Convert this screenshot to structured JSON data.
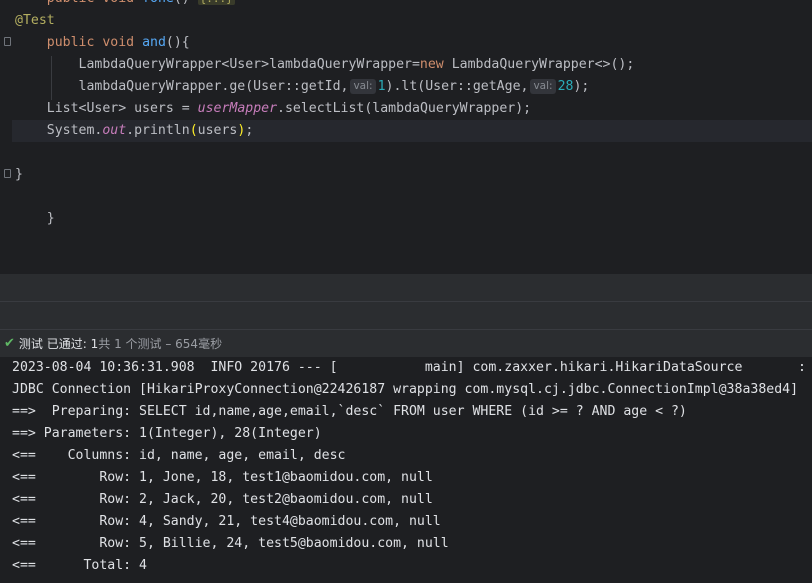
{
  "editor": {
    "lines": [
      {
        "segments": [
          {
            "t": "    "
          },
          {
            "t": "public",
            "c": "kw"
          },
          {
            "t": " "
          },
          {
            "t": "void",
            "c": "kw"
          },
          {
            "t": " "
          },
          {
            "t": "fone",
            "c": "fn"
          },
          {
            "t": "() "
          },
          {
            "t": "{...}",
            "c": "folded"
          }
        ]
      },
      {
        "segments": [
          {
            "t": "@Test",
            "c": "anno"
          }
        ]
      },
      {
        "segments": [
          {
            "t": "    "
          },
          {
            "t": "public",
            "c": "kw"
          },
          {
            "t": " "
          },
          {
            "t": "void",
            "c": "kw"
          },
          {
            "t": " "
          },
          {
            "t": "and",
            "c": "fn"
          },
          {
            "t": "(){"
          }
        ]
      },
      {
        "segments": [
          {
            "t": "        LambdaQueryWrapper<User>lambdaQueryWrapper="
          },
          {
            "t": "new",
            "c": "kw"
          },
          {
            "t": " LambdaQueryWrapper<>();"
          }
        ]
      },
      {
        "segments": [
          {
            "t": "        lambdaQueryWrapper.ge(User::getId,"
          },
          {
            "t": "val:",
            "c": "hint"
          },
          {
            "t": "1",
            "c": "num"
          },
          {
            "t": ").lt(User::getAge,"
          },
          {
            "t": "val:",
            "c": "hint"
          },
          {
            "t": "28",
            "c": "num"
          },
          {
            "t": ");"
          }
        ]
      },
      {
        "segments": [
          {
            "t": "    List<User> "
          },
          {
            "t": "users",
            "c": "var"
          },
          {
            "t": " = "
          },
          {
            "t": "userMapper",
            "c": "field"
          },
          {
            "t": ".selectList(lambdaQueryWrapper);"
          }
        ]
      },
      {
        "segments": [
          {
            "t": "    System."
          },
          {
            "t": "out",
            "c": "field"
          },
          {
            "t": ".println"
          },
          {
            "t": "(",
            "c": "paren-hl"
          },
          {
            "t": "users"
          },
          {
            "t": ")",
            "c": "paren-hl"
          },
          {
            "t": ";"
          }
        ]
      },
      {
        "segments": []
      },
      {
        "segments": [
          {
            "t": "}"
          }
        ]
      },
      {
        "segments": []
      },
      {
        "segments": [
          {
            "t": "    }"
          }
        ]
      }
    ]
  },
  "status": {
    "label": "测试",
    "passed": "已通过:",
    "passed_count": "1",
    "summary": "共 1 个测试 – 654毫秒"
  },
  "console": {
    "lines": [
      "2023-08-04 10:36:31.908  INFO 20176 --- [           main] com.zaxxer.hikari.HikariDataSource       :",
      "JDBC Connection [HikariProxyConnection@22426187 wrapping com.mysql.cj.jdbc.ConnectionImpl@38a38ed4]",
      "==>  Preparing: SELECT id,name,age,email,`desc` FROM user WHERE (id >= ? AND age < ?)",
      "==> Parameters: 1(Integer), 28(Integer)",
      "<==    Columns: id, name, age, email, desc",
      "<==        Row: 1, Jone, 18, test1@baomidou.com, null",
      "<==        Row: 2, Jack, 20, test2@baomidou.com, null",
      "<==        Row: 4, Sandy, 21, test4@baomidou.com, null",
      "<==        Row: 5, Billie, 24, test5@baomidou.com, null",
      "<==      Total: 4"
    ]
  },
  "colors": {
    "editor_bg": "#1e1f22",
    "keyword": "#cf8e6d",
    "annotation": "#b3ae60",
    "method": "#56a8f5",
    "number": "#2aacb8",
    "field": "#c77dbb",
    "pass_green": "#5fb865"
  },
  "icons": {
    "status": "check-icon"
  }
}
